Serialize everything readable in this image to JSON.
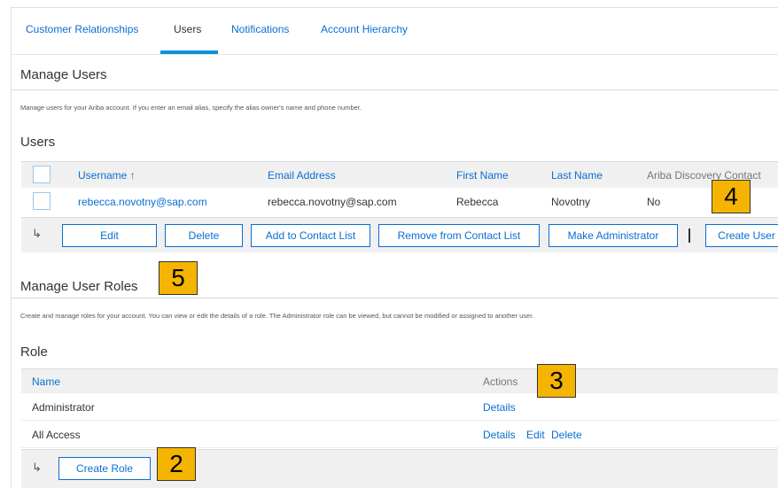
{
  "tabs": [
    {
      "label": "Customer Relationships",
      "active": false
    },
    {
      "label": "Users",
      "active": true
    },
    {
      "label": "Notifications",
      "active": false
    },
    {
      "label": "Account Hierarchy",
      "active": false
    }
  ],
  "manage_users": {
    "title": "Manage Users",
    "description": "Manage users for your Ariba account. If you enter an email alias, specify the alias owner's name and phone number."
  },
  "users": {
    "title": "Users",
    "columns": [
      "Username ↑",
      "Email Address",
      "First Name",
      "Last Name",
      "Ariba Discovery Contact"
    ],
    "rows": [
      {
        "username": "rebecca.novotny@sap.com",
        "email": "rebecca.novotny@sap.com",
        "first_name": "Rebecca",
        "last_name": "Novotny",
        "discovery_contact": "No"
      }
    ],
    "buttons": {
      "edit": "Edit",
      "delete": "Delete",
      "add_contact": "Add to Contact List",
      "remove_contact": "Remove from Contact List",
      "make_admin": "Make Administrator",
      "create_user": "Create User"
    },
    "arrow": "↳",
    "separator": "|"
  },
  "manage_roles": {
    "title": "Manage User Roles",
    "description": "Create and manage roles for your account. You can view or edit the details of a role. The Administrator role can be viewed, but cannot be modified or assigned to another user."
  },
  "roles": {
    "title": "Role",
    "columns": [
      "Name",
      "Actions"
    ],
    "rows": [
      {
        "name": "Administrator",
        "actions": [
          "Details"
        ]
      },
      {
        "name": "All Access",
        "actions": [
          "Details",
          "Edit",
          "Delete"
        ]
      }
    ],
    "create_button": "Create Role",
    "arrow": "↳"
  },
  "callouts": [
    "2",
    "3",
    "4",
    "5"
  ],
  "colors": {
    "link": "#0a6ed1",
    "tab_underline": "#0a91d9",
    "header_bg": "#f0f0f0",
    "callout": "#f4b400"
  }
}
